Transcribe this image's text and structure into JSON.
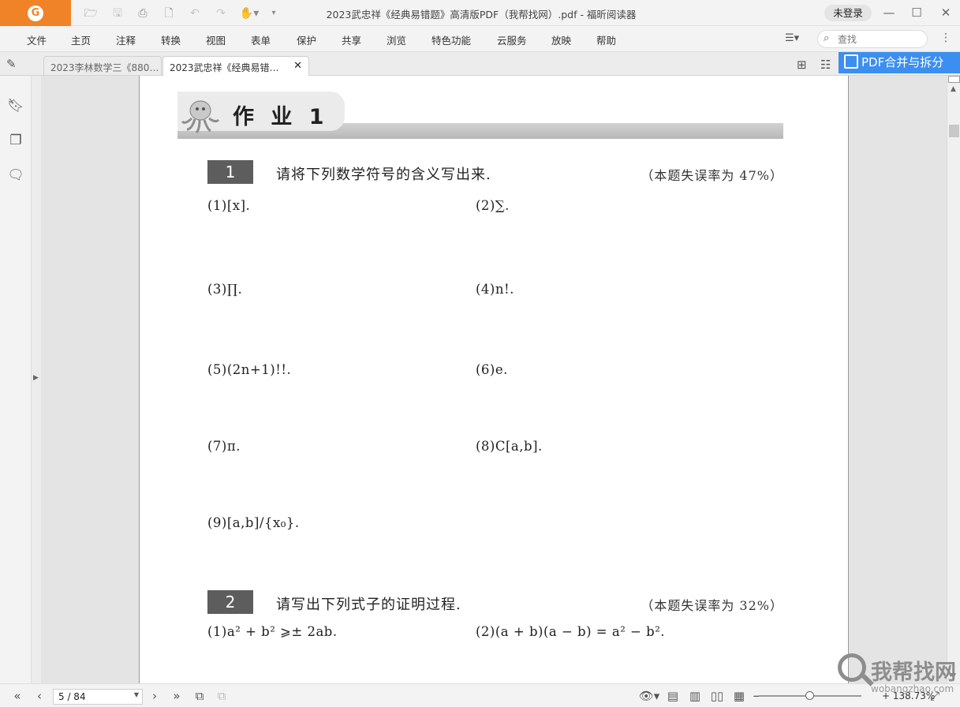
{
  "window": {
    "title": "2023武忠祥《经典易错题》高清版PDF（我帮找网）.pdf - 福昕阅读器",
    "login_label": "未登录",
    "app_logo_letter": "G",
    "accent_color": "#f08328"
  },
  "menu": {
    "items": [
      "文件",
      "主页",
      "注释",
      "转换",
      "视图",
      "表单",
      "保护",
      "共享",
      "浏览",
      "特色功能",
      "云服务",
      "放映",
      "帮助"
    ],
    "search_placeholder": "查找"
  },
  "tabs": [
    {
      "label": "2023李林数学三《880…",
      "active": false
    },
    {
      "label": "2023武忠祥《经典易错…",
      "active": true
    }
  ],
  "promo": {
    "label": "PDF合并与拆分",
    "color": "#3c8ff0"
  },
  "document": {
    "heading": "作 业 1",
    "questions": [
      {
        "number": "1",
        "text": "请将下列数学符号的含义写出来.",
        "rate": "（本题失误率为 47%）",
        "items": [
          "(1)[x].",
          "(2)∑.",
          "(3)∏.",
          "(4)n!.",
          "(5)(2n+1)!!.",
          "(6)e.",
          "(7)π.",
          "(8)C[a,b].",
          "(9)[a,b]/{x₀}."
        ]
      },
      {
        "number": "2",
        "text": "请写出下列式子的证明过程.",
        "rate": "（本题失误率为 32%）",
        "items": [
          "(1)a² + b² ⩾± 2ab.",
          "(2)(a + b)(a − b) = a² − b²."
        ]
      }
    ]
  },
  "status": {
    "page_value": "5 / 84",
    "zoom": "+ 138.73%"
  },
  "watermark": {
    "text": "我帮找网",
    "sub": "wobangzhao.com"
  }
}
